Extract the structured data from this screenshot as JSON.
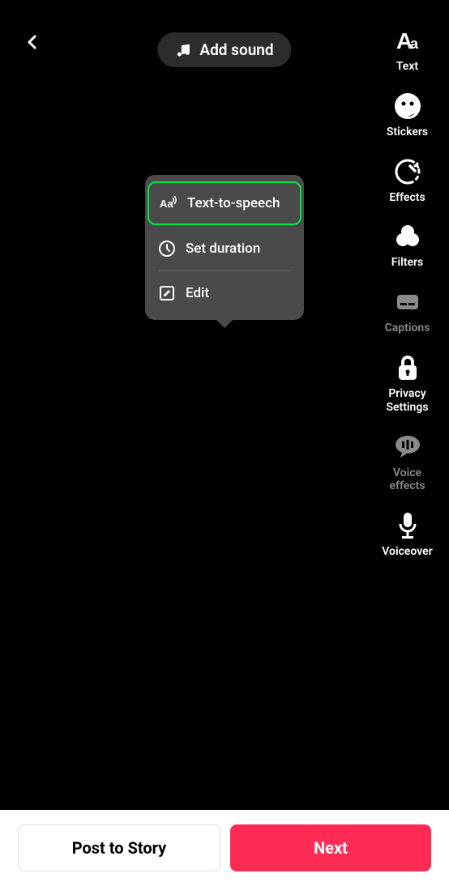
{
  "header": {
    "add_sound": "Add sound"
  },
  "sidebar": {
    "items": [
      {
        "label": "Text",
        "icon": "text"
      },
      {
        "label": "Stickers",
        "icon": "stickers"
      },
      {
        "label": "Effects",
        "icon": "effects"
      },
      {
        "label": "Filters",
        "icon": "filters"
      },
      {
        "label": "Captions",
        "icon": "captions",
        "dim": true
      },
      {
        "label": "Privacy Settings",
        "icon": "privacy"
      },
      {
        "label": "Voice effects",
        "icon": "voice-effects",
        "dim": true
      },
      {
        "label": "Voiceover",
        "icon": "voiceover"
      }
    ]
  },
  "popup": {
    "items": [
      {
        "label": "Text-to-speech",
        "icon": "tts",
        "highlighted": true
      },
      {
        "label": "Set duration",
        "icon": "clock"
      },
      {
        "label": "Edit",
        "icon": "edit"
      }
    ]
  },
  "bottom": {
    "post_to_story": "Post to Story",
    "next": "Next"
  }
}
